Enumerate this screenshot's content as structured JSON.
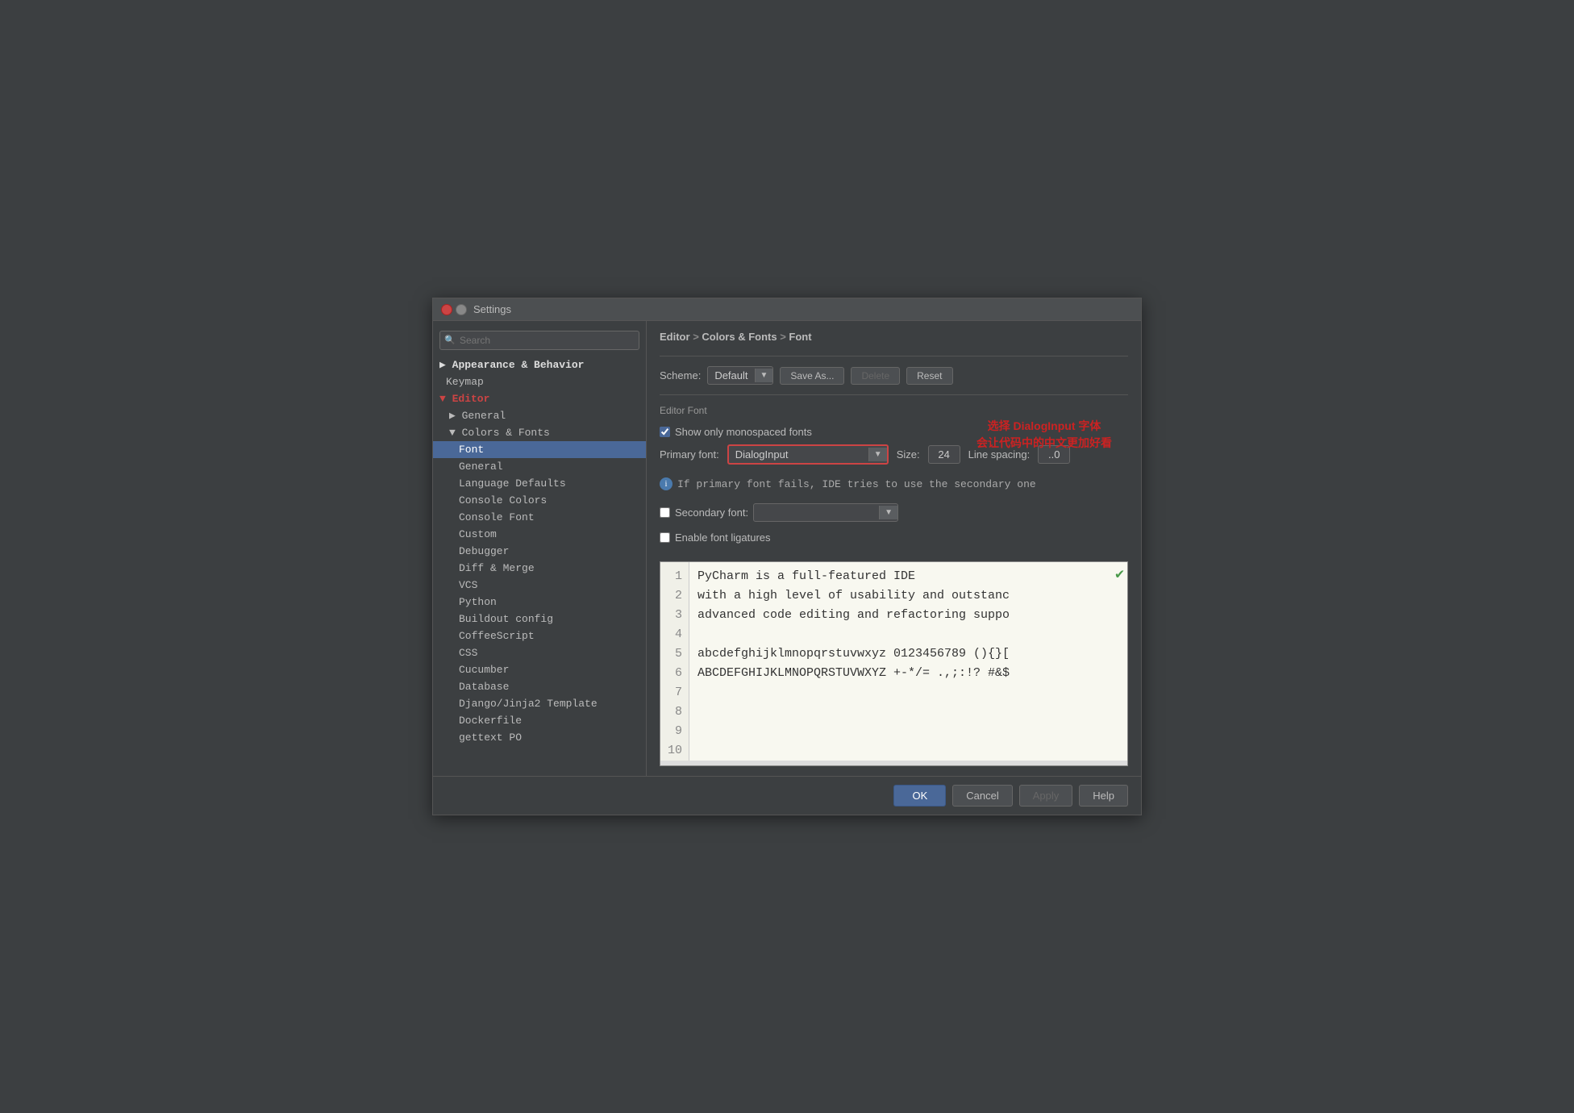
{
  "titlebar": {
    "title": "Settings"
  },
  "search": {
    "placeholder": "Search"
  },
  "breadcrumb": {
    "part1": "Editor",
    "sep1": " > ",
    "part2": "Colors & Fonts",
    "sep2": " > ",
    "part3": "Font"
  },
  "scheme": {
    "label": "Scheme:",
    "value": "Default",
    "buttons": {
      "save_as": "Save As...",
      "delete": "Delete",
      "reset": "Reset"
    }
  },
  "editor_font": {
    "section_label": "Editor Font",
    "checkbox_label": "Show only monospaced fonts",
    "primary_label": "Primary font:",
    "primary_value": "DialogInput",
    "size_label": "Size:",
    "size_value": "24",
    "line_spacing_label": "Line spacing:",
    "line_spacing_value": "..0",
    "info_text": "If primary font fails, IDE tries to use the secondary one",
    "secondary_label": "Secondary font:",
    "secondary_value": "",
    "ligatures_label": "Enable font ligatures"
  },
  "annotation": {
    "line1": "选择 DialogInput 字体",
    "line2": "会让代码中的中文更加好看"
  },
  "preview": {
    "lines": [
      {
        "num": "1",
        "text": "PyCharm is a full-featured IDE",
        "highlight": false
      },
      {
        "num": "2",
        "text": "with a high level of usability and outstanc",
        "highlight": false
      },
      {
        "num": "3",
        "text": "advanced code editing and refactoring suppo",
        "highlight": false
      },
      {
        "num": "4",
        "text": "",
        "highlight": true
      },
      {
        "num": "5",
        "text": "abcdefghijklmnopqrstuvwxyz 0123456789 (){}[",
        "highlight": false
      },
      {
        "num": "6",
        "text": "ABCDEFGHIJKLMNOPQRSTUVWXYZ +-*/= .,;:!? #&$",
        "highlight": false
      },
      {
        "num": "7",
        "text": "",
        "highlight": false
      },
      {
        "num": "8",
        "text": "",
        "highlight": false
      },
      {
        "num": "9",
        "text": "",
        "highlight": false
      },
      {
        "num": "10",
        "text": "",
        "highlight": false
      }
    ]
  },
  "sidebar": {
    "items": [
      {
        "label": "▶ Appearance & Behavior",
        "level": 0,
        "type": "parent"
      },
      {
        "label": "Keymap",
        "level": 0,
        "type": "item"
      },
      {
        "label": "▼ Editor",
        "level": 0,
        "type": "parent-open"
      },
      {
        "label": "▶ General",
        "level": 1,
        "type": "parent"
      },
      {
        "label": "▼ Colors & Fonts",
        "level": 1,
        "type": "parent-open"
      },
      {
        "label": "Font",
        "level": 2,
        "type": "item",
        "selected": true
      },
      {
        "label": "General",
        "level": 2,
        "type": "item"
      },
      {
        "label": "Language Defaults",
        "level": 2,
        "type": "item"
      },
      {
        "label": "Console Colors",
        "level": 2,
        "type": "item"
      },
      {
        "label": "Console Font",
        "level": 2,
        "type": "item"
      },
      {
        "label": "Custom",
        "level": 2,
        "type": "item"
      },
      {
        "label": "Debugger",
        "level": 2,
        "type": "item"
      },
      {
        "label": "Diff & Merge",
        "level": 2,
        "type": "item"
      },
      {
        "label": "VCS",
        "level": 2,
        "type": "item"
      },
      {
        "label": "Python",
        "level": 2,
        "type": "item"
      },
      {
        "label": "Buildout config",
        "level": 2,
        "type": "item"
      },
      {
        "label": "CoffeeScript",
        "level": 2,
        "type": "item"
      },
      {
        "label": "CSS",
        "level": 2,
        "type": "item"
      },
      {
        "label": "Cucumber",
        "level": 2,
        "type": "item"
      },
      {
        "label": "Database",
        "level": 2,
        "type": "item"
      },
      {
        "label": "Django/Jinja2 Template",
        "level": 2,
        "type": "item"
      },
      {
        "label": "Dockerfile",
        "level": 2,
        "type": "item"
      },
      {
        "label": "gettext PO",
        "level": 2,
        "type": "item"
      }
    ]
  },
  "bottom_buttons": {
    "ok": "OK",
    "cancel": "Cancel",
    "apply": "Apply",
    "help": "Help"
  }
}
